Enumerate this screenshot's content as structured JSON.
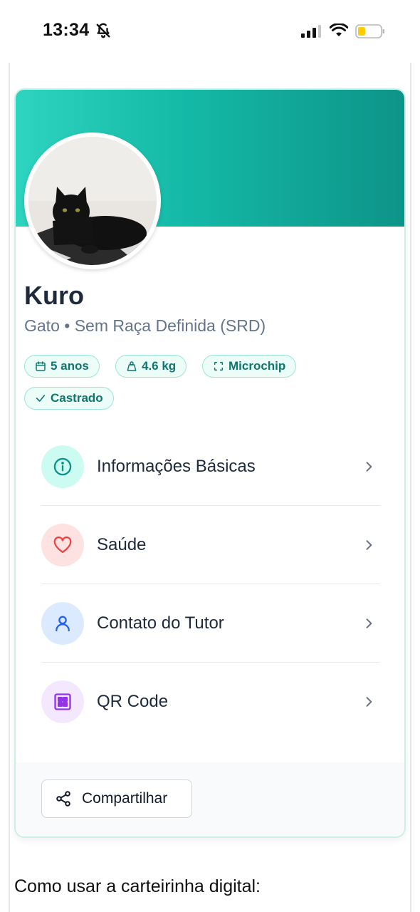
{
  "status_bar": {
    "time": "13:34",
    "icons": [
      "bell-off-icon",
      "signal-icon",
      "wifi-icon",
      "battery-low-icon"
    ]
  },
  "pet": {
    "name": "Kuro",
    "subtitle": "Gato • Sem Raça Definida (SRD)",
    "photo": "black-cat-photo"
  },
  "badges": [
    {
      "label": "5 anos",
      "icon": "calendar-icon"
    },
    {
      "label": "4.6 kg",
      "icon": "weight-icon"
    },
    {
      "label": "Microchip",
      "icon": "scan-icon"
    },
    {
      "label": "Castrado",
      "icon": "check-icon"
    }
  ],
  "menu": [
    {
      "label": "Informações Básicas",
      "icon": "info-icon",
      "color": "#0d9488",
      "bg": "#ccfbf1"
    },
    {
      "label": "Saúde",
      "icon": "heart-icon",
      "color": "#ef4444",
      "bg": "#fee2e2"
    },
    {
      "label": "Contato do Tutor",
      "icon": "user-icon",
      "color": "#2563eb",
      "bg": "#dbeafe"
    },
    {
      "label": "QR Code",
      "icon": "qr-code-icon",
      "color": "#9333ea",
      "bg": "#f3e8ff"
    }
  ],
  "share": {
    "label": "Compartilhar",
    "icon": "share-icon"
  },
  "howto_title": "Como usar a carteirinha digital:",
  "colors": {
    "accent": "#14b8a6",
    "banner_start": "#2dd4bf",
    "banner_end": "#0d9488",
    "badge_text": "#0f766e"
  }
}
